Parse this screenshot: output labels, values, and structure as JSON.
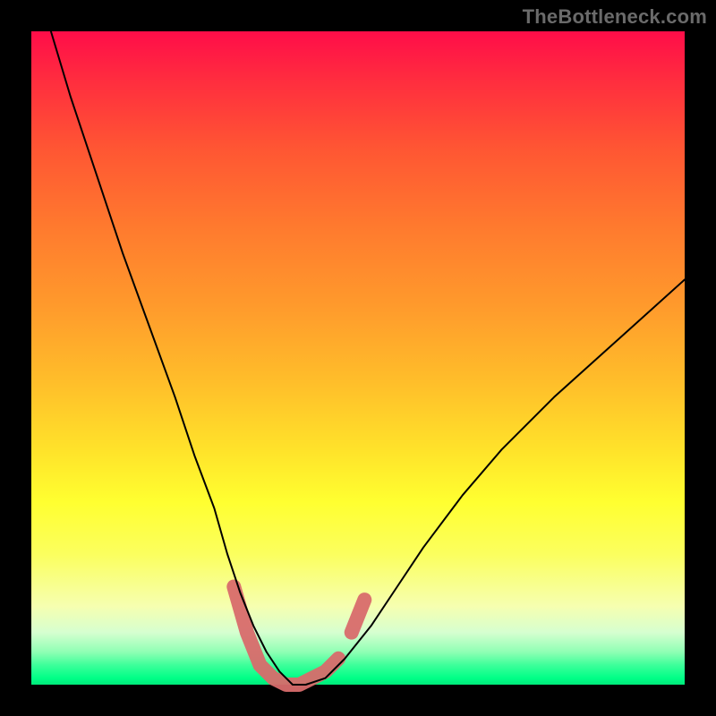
{
  "watermark": "TheBottleneck.com",
  "chart_data": {
    "type": "line",
    "title": "",
    "xlabel": "",
    "ylabel": "",
    "xlim": [
      0,
      100
    ],
    "ylim": [
      0,
      100
    ],
    "grid": false,
    "legend": false,
    "series": [
      {
        "name": "bottleneck-curve",
        "x": [
          3,
          6,
          10,
          14,
          18,
          22,
          25,
          28,
          30,
          32,
          34,
          36,
          38,
          40,
          42,
          45,
          48,
          52,
          56,
          60,
          66,
          72,
          80,
          90,
          100
        ],
        "y": [
          100,
          90,
          78,
          66,
          55,
          44,
          35,
          27,
          20,
          14,
          9,
          5,
          2,
          0,
          0,
          1,
          4,
          9,
          15,
          21,
          29,
          36,
          44,
          53,
          62
        ]
      }
    ],
    "highlight": {
      "name": "bottom-notch",
      "segments": [
        {
          "x": [
            31,
            33,
            35,
            37,
            39,
            41,
            43,
            45,
            47
          ],
          "y": [
            15,
            8,
            3,
            1,
            0,
            0,
            1,
            2,
            4
          ]
        },
        {
          "x": [
            49,
            51
          ],
          "y": [
            8,
            13
          ]
        }
      ]
    },
    "background_gradient": {
      "direction": "vertical",
      "stops": [
        {
          "pos": 0.0,
          "color": "#ff0d49"
        },
        {
          "pos": 0.3,
          "color": "#ff7a2e"
        },
        {
          "pos": 0.64,
          "color": "#ffe22a"
        },
        {
          "pos": 0.88,
          "color": "#f6ffb0"
        },
        {
          "pos": 1.0,
          "color": "#00e87a"
        }
      ]
    }
  }
}
